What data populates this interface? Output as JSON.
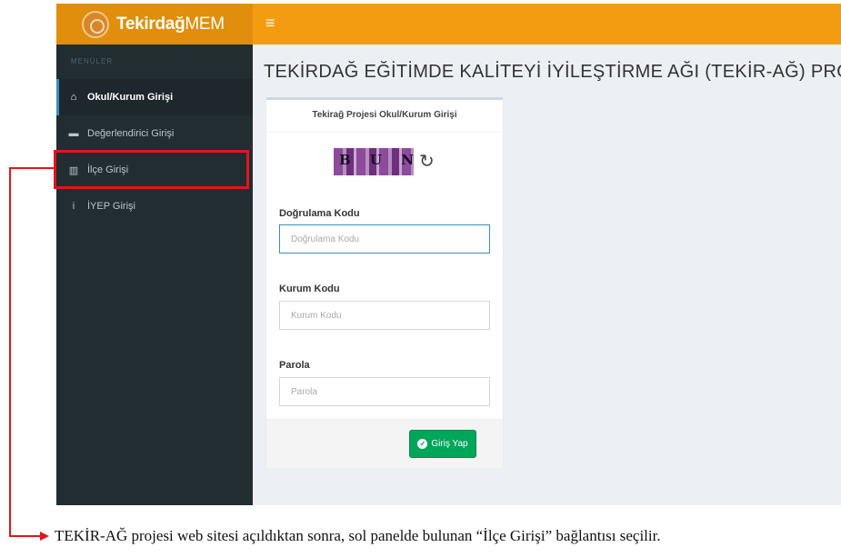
{
  "header": {
    "brand_bold": "Tekirdağ",
    "brand_light": "MEM",
    "menu_icon": "≡"
  },
  "sidebar": {
    "section_header": "MENÜLER",
    "items": [
      {
        "icon": "home-icon",
        "glyph": "⌂",
        "label": "Okul/Kurum Girişi",
        "active": true
      },
      {
        "icon": "briefcase-icon",
        "glyph": "▬",
        "label": "Değerlendirici Girişi",
        "active": false
      },
      {
        "icon": "bank-icon",
        "glyph": "▥",
        "label": "İlçe Girişi",
        "active": false
      },
      {
        "icon": "info-icon",
        "glyph": "i",
        "label": "İYEP Girişi",
        "active": false
      }
    ]
  },
  "main": {
    "page_title": "TEKİRDAĞ EĞİTİMDE KALİTEYİ İYİLEŞTİRME AĞI (TEKİR-AĞ) PROJESİ"
  },
  "login": {
    "title": "Tekirağ Projesi Okul/Kurum Girişi",
    "captcha_text": "B U N",
    "refresh_glyph": "↻",
    "fields": {
      "verification": {
        "label": "Doğrulama Kodu",
        "placeholder": "Doğrulama Kodu",
        "value": ""
      },
      "institution": {
        "label": "Kurum Kodu",
        "placeholder": "Kurum Kodu",
        "value": ""
      },
      "password": {
        "label": "Parola",
        "placeholder": "Parola",
        "value": ""
      }
    },
    "submit_label": "Giriş Yap"
  },
  "annotation": {
    "caption": "TEKİR-AĞ projesi web sitesi açıldıktan sonra, sol panelde bulunan “İlçe Girişi” bağlantısı seçilir.",
    "highlight_color": "#e3141b"
  },
  "colors": {
    "topbar": "#f39c12",
    "sidebar": "#222d32",
    "submit": "#00a65a"
  }
}
